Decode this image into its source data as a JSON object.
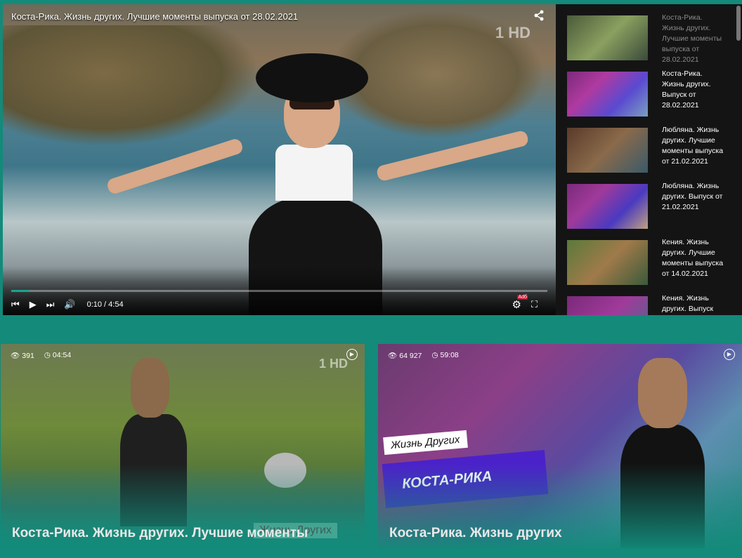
{
  "player": {
    "title": "Коста-Рика. Жизнь других. Лучшие моменты выпуска от 28.02.2021",
    "channel_logo": "1 HD",
    "progress": 0.034,
    "time": "0:10 / 4:54",
    "adv_badge": "Adб",
    "icons": {
      "share": "share-icon",
      "prev": "previous-icon",
      "play": "play-icon",
      "next": "next-icon",
      "volume": "volume-icon",
      "settings": "settings-icon",
      "fullscreen": "fullscreen-icon"
    }
  },
  "playlist": [
    {
      "title": "Коста-Рика. Жизнь других. Лучшие моменты выпуска от 28.02.2021",
      "active": true
    },
    {
      "title": "Коста-Рика. Жизнь других. Выпуск от 28.02.2021",
      "active": false
    },
    {
      "title": "Любляна. Жизнь других. Лучшие моменты выпуска от 21.02.2021",
      "active": false
    },
    {
      "title": "Любляна. Жизнь других. Выпуск от 21.02.2021",
      "active": false
    },
    {
      "title": "Кения. Жизнь других. Лучшие моменты выпуска от 14.02.2021",
      "active": false
    },
    {
      "title": "Кения. Жизнь других. Выпуск",
      "active": false
    }
  ],
  "cards": [
    {
      "views": "391",
      "duration": "04:54",
      "title": "Коста-Рика. Жизнь других. Лучшие моменты",
      "watermark": "Жизнь Других",
      "logo": "1 HD"
    },
    {
      "views": "64 927",
      "duration": "59:08",
      "title": "Коста-Рика. Жизнь других",
      "badge_show": "Жизнь Других",
      "badge_country": "КОСТА-РИКА"
    }
  ],
  "colors": {
    "background": "#138a7a",
    "sidebar": "#141414",
    "progress": "#1ea38f"
  }
}
